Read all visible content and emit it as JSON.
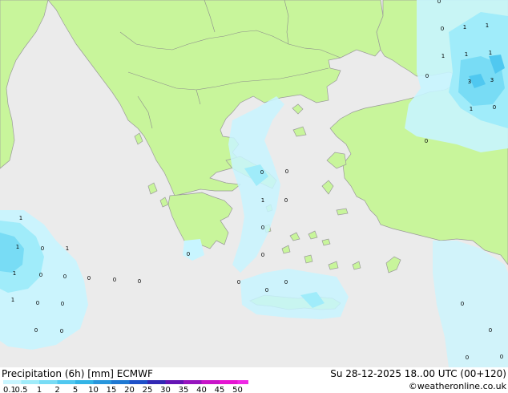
{
  "footer": {
    "title": "Precipitation (6h) [mm] ECMWF",
    "datetime": "Su 28-12-2025 18..00 UTC (00+120)",
    "credit": "©weatheronline.co.uk"
  },
  "legend": {
    "ticks": [
      "0.1",
      "0.5",
      "1",
      "2",
      "5",
      "10",
      "15",
      "20",
      "25",
      "30",
      "35",
      "40",
      "45",
      "50"
    ],
    "colors": [
      "#c8f5ff",
      "#a0ecfa",
      "#78dcf5",
      "#50c8f0",
      "#32b4e6",
      "#2896dc",
      "#1e78d2",
      "#1e50c8",
      "#3228b4",
      "#6414b4",
      "#9614be",
      "#c814c8",
      "#e614d2",
      "#f028e6"
    ]
  },
  "map": {
    "land_color": "#c8f59b",
    "sea_color": "#ebebeb",
    "precip_light": "#c8f5ff",
    "precip_mid": "#a0ecfa",
    "precip_strong": "#78dcf5",
    "precip_peak": "#50c8f0",
    "values": [
      "0",
      "0",
      "1",
      "1",
      "1",
      "1",
      "0",
      "1",
      "3",
      "3",
      "1",
      "0",
      "0",
      "0",
      "1",
      "0",
      "0",
      "0",
      "0",
      "0",
      "0",
      "1",
      "1",
      "0",
      "1",
      "1",
      "0",
      "0",
      "0",
      "0",
      "0",
      "1",
      "0",
      "0",
      "0",
      "0",
      "0",
      "0",
      "0",
      "0",
      "0",
      "0"
    ]
  }
}
